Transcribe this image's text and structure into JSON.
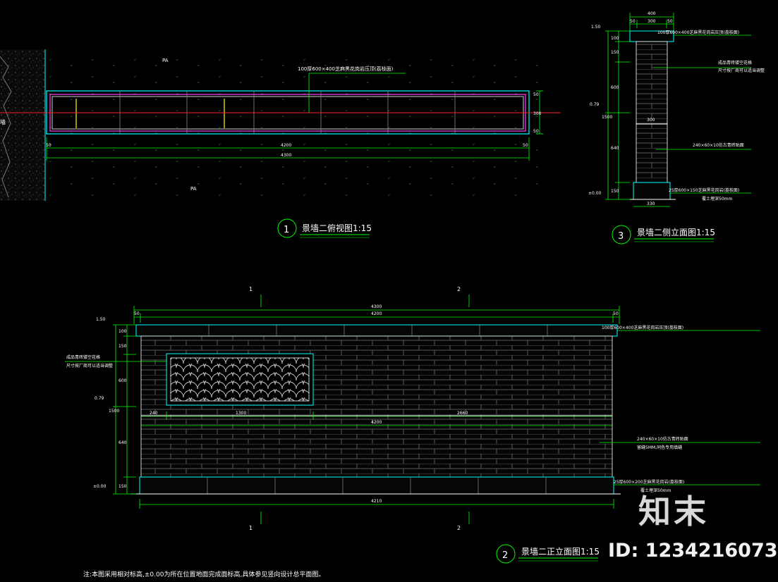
{
  "plan_view": {
    "title": "景墙二俯视图1:15",
    "number": "1",
    "material_note": "100厚600×400芝麻黑花岗岩压顶(荔枝面)",
    "pa_top": "PA",
    "pa_bottom": "PA",
    "left_edge_label": "墙",
    "dim_total_inner": "4200",
    "dim_total_outer": "4300",
    "dim_left": "50",
    "dim_right": "50",
    "dim_side_a": "50",
    "dim_side_b": "300",
    "dim_side_c": "50"
  },
  "side_elevation": {
    "title": "景墙二侧立面图1:15",
    "number": "3",
    "top_dim_total": "400",
    "top_dim_a": "50",
    "top_dim_b": "300",
    "top_dim_c": "50",
    "level_top": "1.50",
    "level_mid": "0.79",
    "level_bottom": "±0.00",
    "dim_h1": "100",
    "dim_h2": "150",
    "dim_h3": "600",
    "dim_h4": "1500",
    "dim_h5": "640",
    "dim_h6": "150",
    "inner_dim": "300",
    "bottom_dim": "330",
    "note_cap": "100厚600×400芝麻黑花岗岩压顶(荔枝面)",
    "note_panel_1": "成品青砖镂空花格",
    "note_panel_2": "尺寸按厂商可以适当调整",
    "note_brick": "240×60×10仿古青砖贴面",
    "note_base": "25厚600×150芝麻黑花岗岩(荔枝面)",
    "note_soil": "覆土埋深50mm"
  },
  "front_elevation": {
    "title": "景墙二正立面图1:15",
    "number": "2",
    "axis_1": "1",
    "axis_2": "2",
    "dim_top_outer": "4300",
    "dim_top_inner": "4200",
    "dim_top_left": "50",
    "dim_top_right": "50",
    "level_top": "1.50",
    "level_mid": "0.79",
    "level_bottom": "±0.00",
    "dim_h1": "100",
    "dim_h2": "150",
    "dim_h3": "600",
    "dim_h4": "1500",
    "dim_h5": "640",
    "dim_h6": "150",
    "dim_seg_a": "240",
    "dim_seg_b": "1300",
    "dim_seg_c": "2660",
    "dim_mid_total": "4200",
    "dim_bottom": "4210",
    "note_cap": "100厚600×400芝麻黑花岗岩压顶(荔枝面)",
    "note_panel_1": "成品青砖镂空花格",
    "note_panel_2": "尺寸按厂商可以适当调整",
    "note_brick_1": "240×60×10仿古青砖贴面",
    "note_brick_2": "留缝5MM,同色专用填缝",
    "note_base": "25厚600×200芝麻黑花岗岩(荔枝面)",
    "note_soil": "覆土埋深50mm"
  },
  "footer_note": "注:本图采用相对标高,±0.00为所在位置地面完成面标高,具体参见竖向设计总平面图。",
  "watermark": {
    "brand": "知末",
    "image_id": "ID: 1234216073"
  },
  "colors": {
    "background": "#000000",
    "dim_line": "#00ff00",
    "outline": "#00ffff",
    "wall": "#ffffff",
    "centerline": "#ff2020",
    "inner_frame": "#ff40ff",
    "marker": "#ffff00"
  }
}
